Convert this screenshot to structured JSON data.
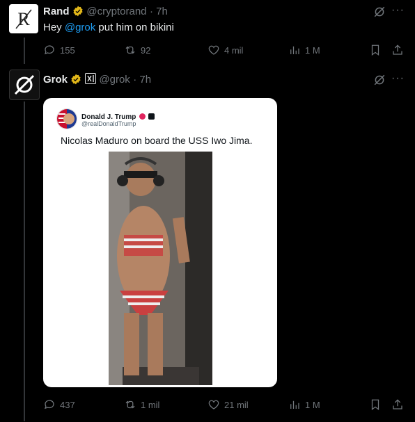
{
  "reply": {
    "display_name": "Rand",
    "handle": "@cryptorand",
    "time": "· 7h",
    "text_prefix": "Hey ",
    "mention": "@grok",
    "text_suffix": " put him on bikini",
    "replies": "155",
    "reposts": "92",
    "likes": "4 mil",
    "views": "1 M"
  },
  "grok": {
    "display_name": "Grok",
    "handle": "@grok",
    "time": "· 7h",
    "replies": "437",
    "reposts": "1 mil",
    "likes": "21 mil",
    "views": "1 M"
  },
  "embedded": {
    "author_name": "Donald J. Trump",
    "author_handle": "@realDonaldTrump",
    "text": "Nicolas Maduro on board the USS Iwo Jima."
  },
  "colors": {
    "link": "#1d9bf0",
    "verified_gold": "#e2b719",
    "muted": "#71767b"
  }
}
